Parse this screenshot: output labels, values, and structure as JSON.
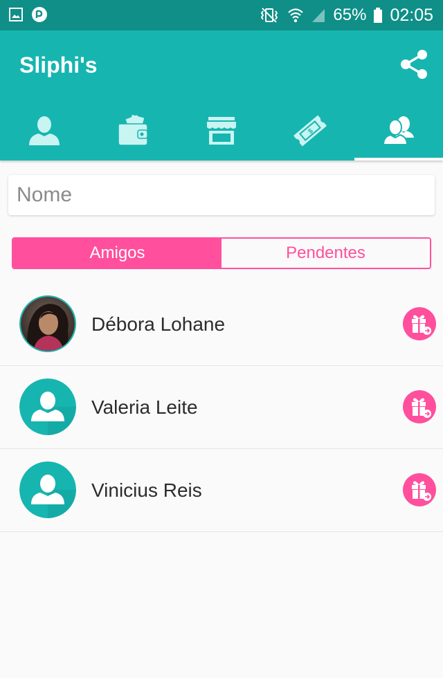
{
  "status_bar": {
    "battery": "65%",
    "time": "02:05",
    "icons": [
      "gallery-icon",
      "app-notification-icon",
      "vibrate-icon",
      "wifi-icon",
      "signal-icon",
      "battery-icon"
    ]
  },
  "app_bar": {
    "title": "Sliphi's",
    "action_icon": "share-icon"
  },
  "tabs": [
    {
      "icon": "profile-icon",
      "active": false
    },
    {
      "icon": "wallet-icon",
      "active": false
    },
    {
      "icon": "store-icon",
      "active": false
    },
    {
      "icon": "ticket-icon",
      "active": false
    },
    {
      "icon": "friends-icon",
      "active": true
    }
  ],
  "search": {
    "placeholder": "Nome",
    "value": ""
  },
  "segment": {
    "options": [
      "Amigos",
      "Pendentes"
    ],
    "selected": "Amigos"
  },
  "friends": [
    {
      "name": "Débora Lohane",
      "avatar": "photo",
      "action_icon": "gift-icon"
    },
    {
      "name": "Valeria Leite",
      "avatar": "default-user-icon",
      "action_icon": "gift-icon"
    },
    {
      "name": "Vinicius Reis",
      "avatar": "default-user-icon",
      "action_icon": "gift-icon"
    }
  ],
  "colors": {
    "status_bar": "#0f8f88",
    "primary": "#17b5b0",
    "accent": "#ff4f9d",
    "background": "#fafafa"
  }
}
